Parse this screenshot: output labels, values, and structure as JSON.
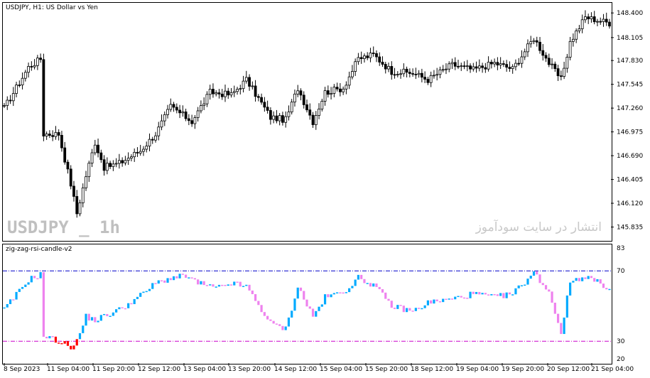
{
  "main_chart": {
    "title": "USDJPY, H1:  US Dollar vs Yen",
    "watermark_symbol": "USDJPY _ 1h",
    "watermark_text": "انتشار در سایت سودآموز",
    "price_ticks": [
      "148.400",
      "148.105",
      "147.830",
      "147.545",
      "147.260",
      "146.975",
      "146.690",
      "146.405",
      "146.120",
      "145.835"
    ]
  },
  "indicator": {
    "title": "zig-zag-rsi-candle-v2",
    "levels": [
      "83",
      "70",
      "30",
      "20"
    ]
  },
  "time_axis": {
    "labels": [
      "8 Sep 2023",
      "11 Sep 04:00",
      "11 Sep 20:00",
      "12 Sep 12:00",
      "13 Sep 04:00",
      "13 Sep 20:00",
      "14 Sep 12:00",
      "15 Sep 04:00",
      "15 Sep 20:00",
      "18 Sep 12:00",
      "19 Sep 04:00",
      "19 Sep 20:00",
      "20 Sep 12:00",
      "21 Sep 04:00"
    ]
  },
  "colors": {
    "bull_rsi": "#00aaff",
    "bear_rsi": "#ee82ee",
    "overbought": "#ff0000",
    "oversold": "#0000ff",
    "level_70": "#0000cc",
    "level_30": "#cc00cc"
  },
  "chart_data": [
    {
      "type": "candlestick",
      "title": "USDJPY, H1:  US Dollar vs Yen",
      "ylim": [
        145.78,
        148.47
      ],
      "waypoints": [
        [
          0,
          147.26
        ],
        [
          8,
          147.75
        ],
        [
          12,
          147.85
        ],
        [
          13,
          146.95
        ],
        [
          18,
          146.95
        ],
        [
          22,
          146.35
        ],
        [
          24,
          146.0
        ],
        [
          27,
          146.45
        ],
        [
          30,
          146.85
        ],
        [
          33,
          146.55
        ],
        [
          38,
          146.6
        ],
        [
          45,
          146.75
        ],
        [
          50,
          146.95
        ],
        [
          55,
          147.28
        ],
        [
          62,
          147.1
        ],
        [
          68,
          147.45
        ],
        [
          75,
          147.42
        ],
        [
          80,
          147.6
        ],
        [
          88,
          147.15
        ],
        [
          93,
          147.12
        ],
        [
          97,
          147.5
        ],
        [
          102,
          147.1
        ],
        [
          106,
          147.45
        ],
        [
          112,
          147.5
        ],
        [
          117,
          147.85
        ],
        [
          122,
          147.9
        ],
        [
          128,
          147.7
        ],
        [
          135,
          147.68
        ],
        [
          140,
          147.6
        ],
        [
          148,
          147.78
        ],
        [
          155,
          147.72
        ],
        [
          162,
          147.8
        ],
        [
          168,
          147.73
        ],
        [
          175,
          148.1
        ],
        [
          180,
          147.8
        ],
        [
          184,
          147.6
        ],
        [
          187,
          148.05
        ],
        [
          192,
          148.35
        ],
        [
          200,
          148.28
        ]
      ]
    },
    {
      "type": "indicator-candles",
      "title": "zig-zag-rsi-candle-v2",
      "ylim": [
        20,
        83
      ],
      "levels": [
        70,
        30
      ],
      "waypoints": [
        [
          0,
          48
        ],
        [
          8,
          65
        ],
        [
          12,
          68
        ],
        [
          13,
          33
        ],
        [
          18,
          30
        ],
        [
          22,
          27
        ],
        [
          24,
          30
        ],
        [
          27,
          44
        ],
        [
          30,
          42
        ],
        [
          38,
          48
        ],
        [
          45,
          56
        ],
        [
          50,
          63
        ],
        [
          55,
          66
        ],
        [
          60,
          67
        ],
        [
          64,
          63
        ],
        [
          70,
          60
        ],
        [
          75,
          63
        ],
        [
          80,
          61
        ],
        [
          88,
          40
        ],
        [
          93,
          37
        ],
        [
          97,
          61
        ],
        [
          102,
          44
        ],
        [
          106,
          55
        ],
        [
          112,
          58
        ],
        [
          117,
          66
        ],
        [
          122,
          62
        ],
        [
          128,
          50
        ],
        [
          135,
          47
        ],
        [
          140,
          52
        ],
        [
          148,
          54
        ],
        [
          155,
          57
        ],
        [
          162,
          55
        ],
        [
          168,
          57
        ],
        [
          175,
          69
        ],
        [
          180,
          58
        ],
        [
          184,
          35
        ],
        [
          187,
          64
        ],
        [
          192,
          67
        ],
        [
          200,
          60
        ]
      ]
    }
  ]
}
